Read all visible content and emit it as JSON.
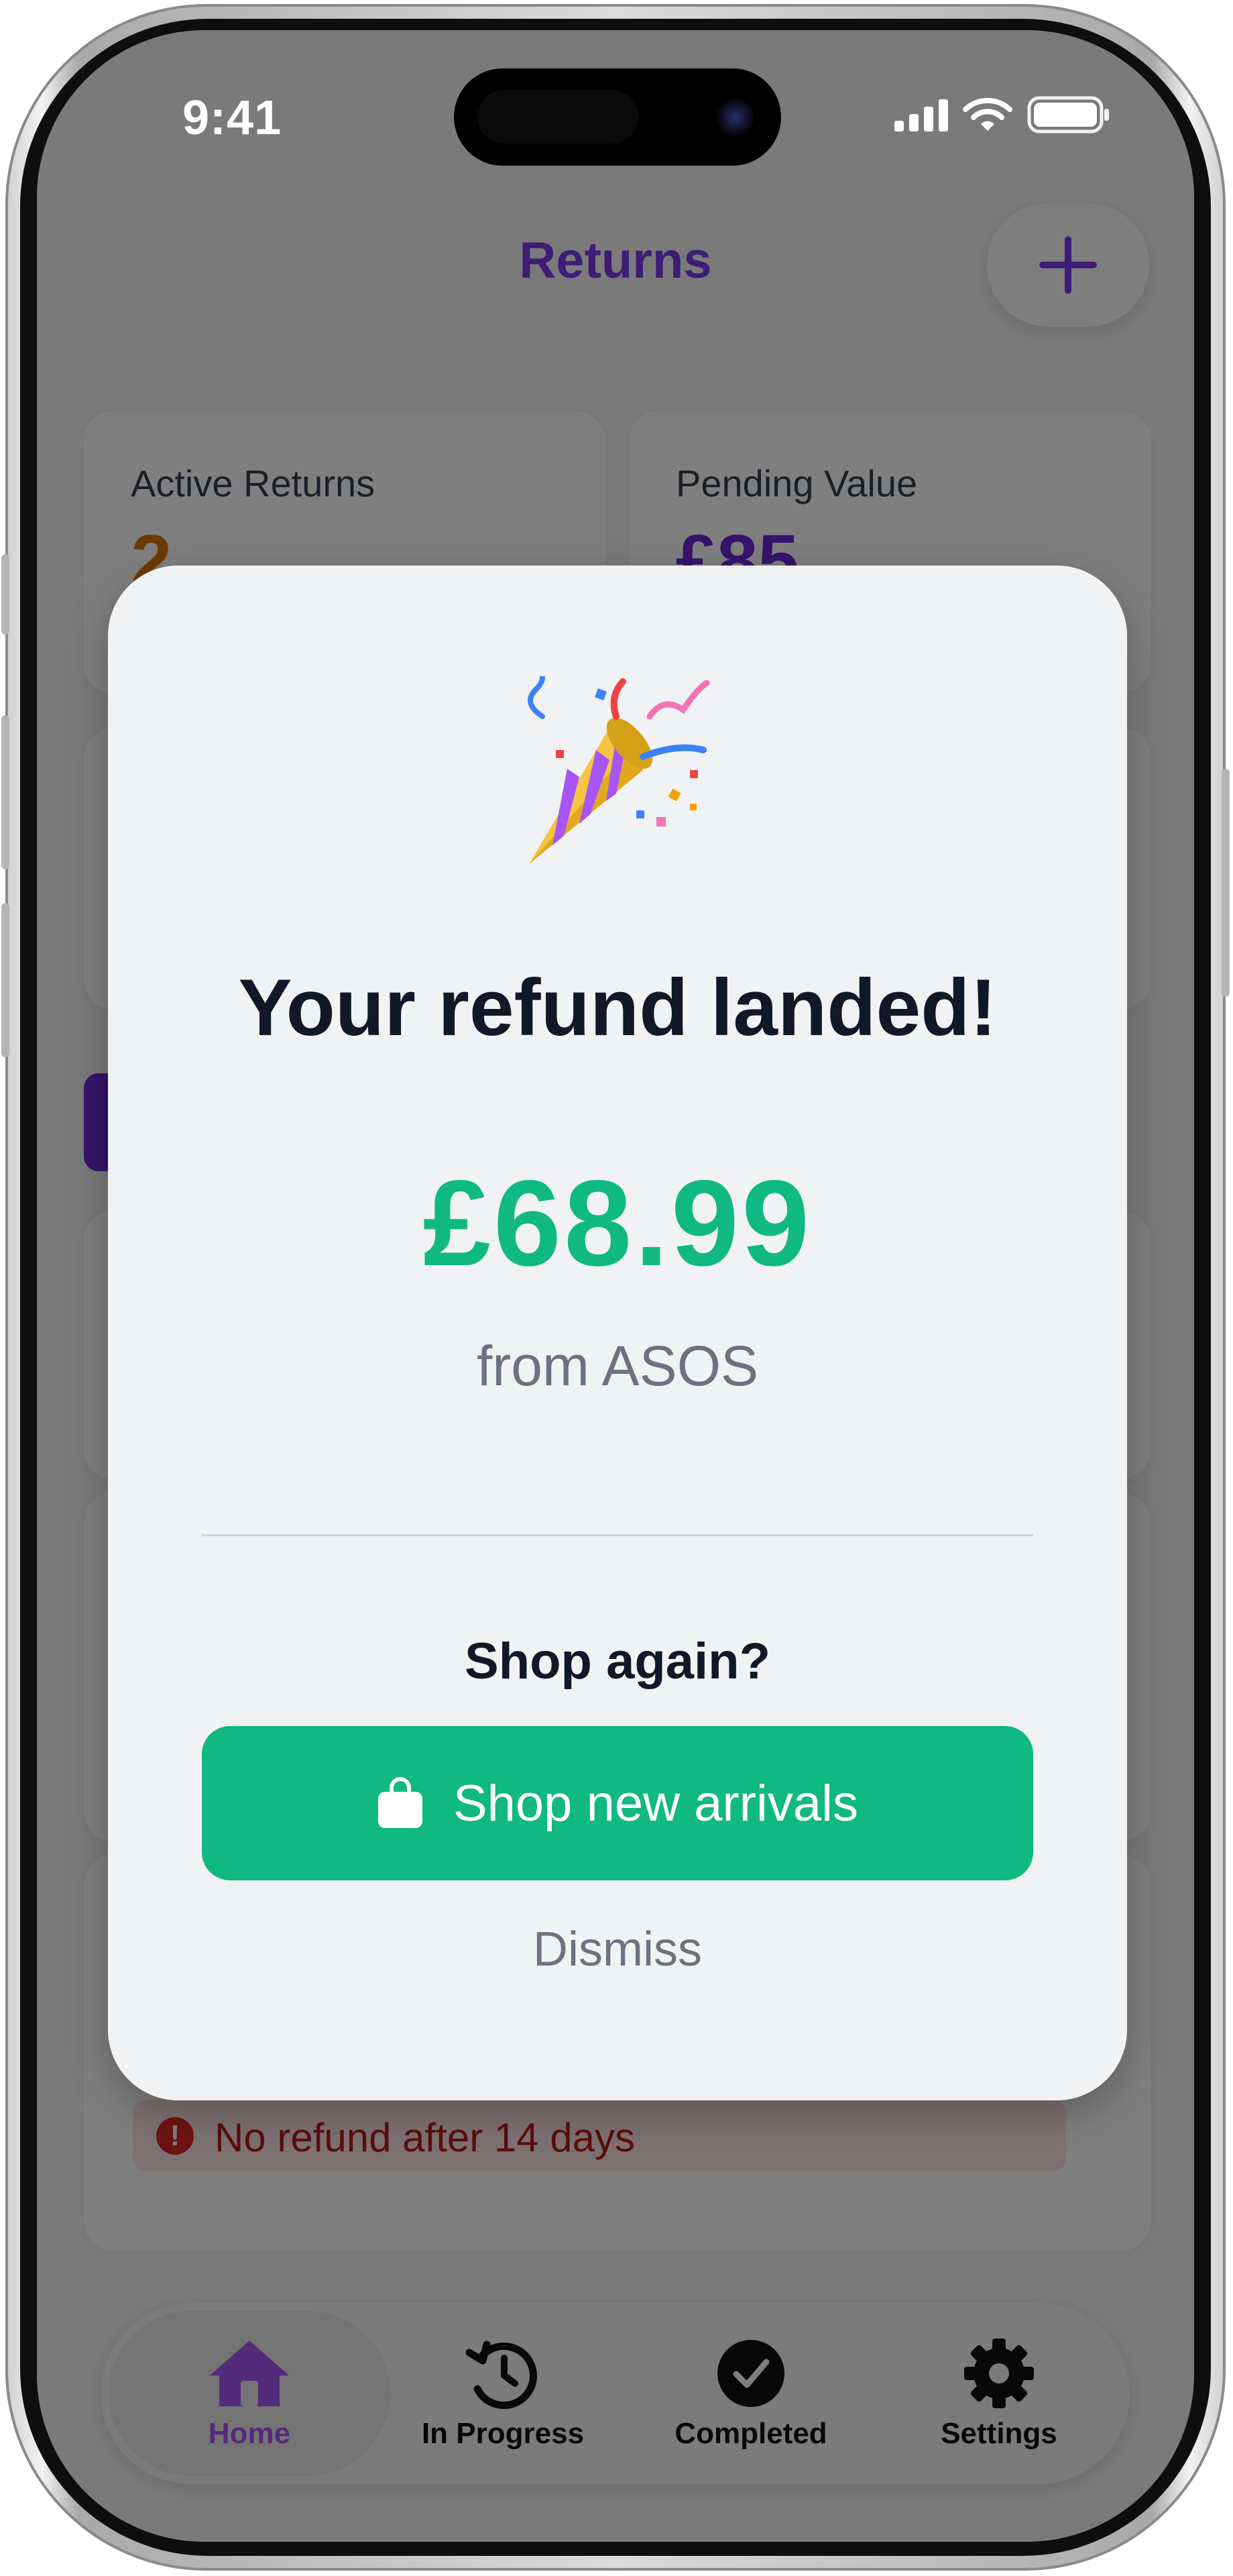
{
  "status_bar": {
    "time": "9:41"
  },
  "header": {
    "title": "Returns"
  },
  "stats": [
    {
      "label": "Active Returns",
      "value": "2",
      "color": "#d97706"
    },
    {
      "label": "Pending Value",
      "value": "£85",
      "color": "#6d28d9"
    }
  ],
  "warning": {
    "text": "No refund after 14 days"
  },
  "tabs": [
    {
      "label": "Home",
      "icon": "house-icon",
      "active": true
    },
    {
      "label": "In Progress",
      "icon": "clock-history-icon",
      "active": false
    },
    {
      "label": "Completed",
      "icon": "check-circle-icon",
      "active": false
    },
    {
      "label": "Settings",
      "icon": "gear-icon",
      "active": false
    }
  ],
  "modal": {
    "emoji": "party-popper-icon",
    "title": "Your refund landed!",
    "amount": "£68.99",
    "from": "from ASOS",
    "question": "Shop again?",
    "shop_button_label": "Shop new arrivals",
    "dismiss_label": "Dismiss"
  },
  "colors": {
    "accent": "#7c3aed",
    "success": "#10b981",
    "danger": "#dc2626"
  }
}
